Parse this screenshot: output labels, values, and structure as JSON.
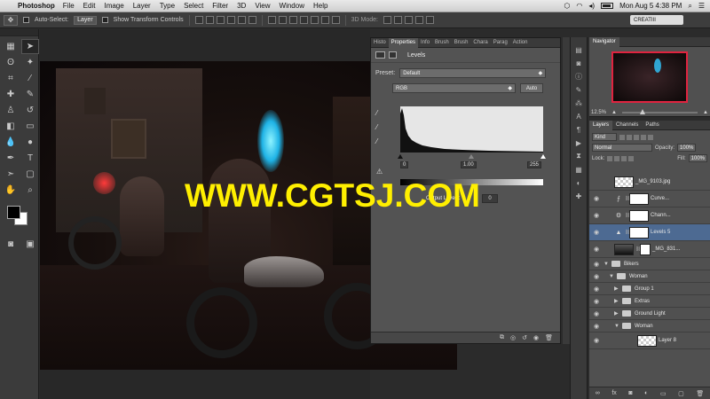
{
  "menubar": {
    "app": "Photoshop",
    "items": [
      "File",
      "Edit",
      "Image",
      "Layer",
      "Type",
      "Select",
      "Filter",
      "3D",
      "View",
      "Window",
      "Help"
    ],
    "time": "Mon Aug 5  4:38 PM"
  },
  "options": {
    "auto_select": "Auto-Select:",
    "auto_select_value": "Layer",
    "show_transform": "Show Transform Controls",
    "mode_3d": "3D Mode:",
    "workspace": "CREATIII"
  },
  "watermark": "WWW.CGTSJ.COM",
  "properties": {
    "tabs": [
      "Histo",
      "Properties",
      "Info",
      "Brush",
      "Brush",
      "Chara",
      "Parag",
      "Action"
    ],
    "title": "Levels",
    "preset_label": "Preset:",
    "preset_value": "Default",
    "channel": "RGB",
    "auto_label": "Auto",
    "input_black": "0",
    "input_gamma": "1.00",
    "input_white": "255",
    "output_label": "Output Levels:",
    "output_black": "0"
  },
  "navigator": {
    "title": "Navigator",
    "zoom": "12.5%"
  },
  "layers_panel": {
    "tabs": [
      "Layers",
      "Channels",
      "Paths"
    ],
    "filter_kind": "Kind",
    "blend_mode": "Normal",
    "opacity_label": "Opacity:",
    "opacity_value": "100%",
    "lock_label": "Lock:",
    "fill_label": "Fill:",
    "fill_value": "100%",
    "layers": [
      {
        "name": "_MG_9103.jpg",
        "visible": false,
        "kind": "check"
      },
      {
        "name": "Curve...",
        "visible": true,
        "kind": "adj"
      },
      {
        "name": "Chann...",
        "visible": true,
        "kind": "adj"
      },
      {
        "name": "Levels 5",
        "visible": true,
        "kind": "adj",
        "selected": true
      },
      {
        "name": "_MG_831...",
        "visible": true,
        "kind": "photo"
      }
    ],
    "groups": [
      {
        "name": "Bikers",
        "depth": 0
      },
      {
        "name": "Woman",
        "depth": 1
      },
      {
        "name": "Group 1",
        "depth": 2
      },
      {
        "name": "Extras",
        "depth": 2
      },
      {
        "name": "Ground Light",
        "depth": 2
      },
      {
        "name": "Woman",
        "depth": 2
      }
    ],
    "last_layer": "Layer 8"
  },
  "colors": {
    "watermark": "#ffef00",
    "selected_layer": "#4d6a92",
    "navigator_frame": "#e0233f"
  }
}
